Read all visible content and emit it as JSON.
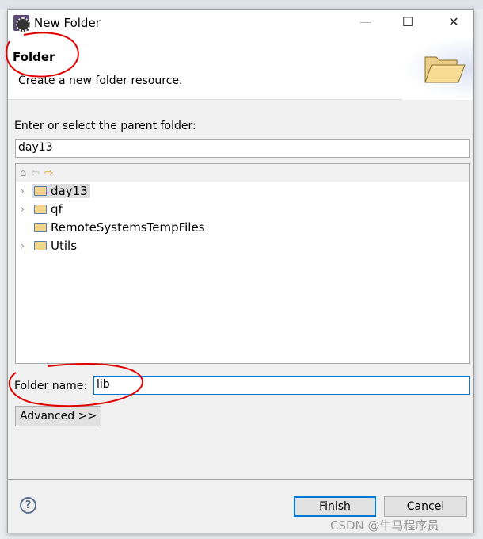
{
  "window": {
    "title": "New Folder",
    "minimize": "—",
    "maximize": "☐",
    "close": "✕"
  },
  "header": {
    "title": "Folder",
    "description": "Create a new folder resource."
  },
  "parent": {
    "label": "Enter or select the parent folder:",
    "value": "day13"
  },
  "tree": {
    "toolbar": {
      "home": "⌂",
      "back": "⇦",
      "forward": "⇨"
    },
    "items": [
      {
        "label": "day13",
        "expandable": true,
        "selected": true
      },
      {
        "label": "qf",
        "expandable": true
      },
      {
        "label": "RemoteSystemsTempFiles",
        "expandable": false
      },
      {
        "label": "Utils",
        "expandable": true
      }
    ]
  },
  "folder_name": {
    "label": "Folder name:",
    "value": "lib"
  },
  "advanced_label": "Advanced >>",
  "help": "?",
  "finish_label": "Finish",
  "cancel_label": "Cancel",
  "watermark": "CSDN @牛马程序员",
  "colors": {
    "annotation": "#e00000",
    "focus": "#0078d7"
  }
}
